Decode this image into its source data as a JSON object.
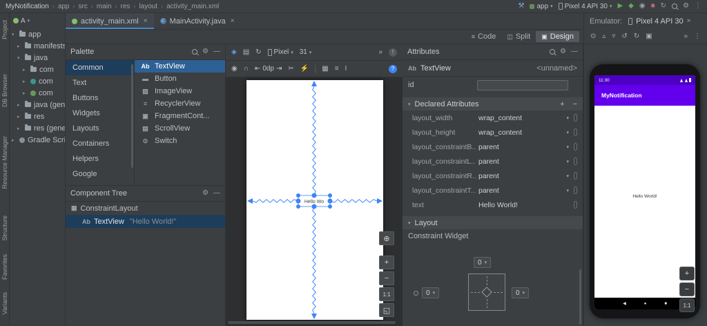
{
  "colors": {
    "accent": "#3d84f7",
    "tab_underline": "#4a88c7",
    "sel_bright": "#2d6094",
    "sel_dim": "#1d3d5a",
    "appbar_purple": "#6200ee",
    "statusbar_purple": "#4d00c4"
  },
  "icons": {
    "chevron_down": "▾",
    "chevron_right": "▸",
    "crumb_sep": "›",
    "gear": "⚙",
    "minimize": "—",
    "close": "×",
    "plus": "+",
    "minus": "−",
    "run": "▶",
    "debug": "◆",
    "profile": "◉",
    "stop": "■",
    "build": "⚒",
    "sync": "↻",
    "more_v": "⋮",
    "more_h": "»",
    "eye": "◉",
    "magnet": "∩",
    "margin_l": "⇤",
    "margin_r": "⇥",
    "clear_constraints": "✂",
    "infer_constraints": "⚡",
    "pack": "▦",
    "align": "≡",
    "guidelines": "I",
    "help": "?",
    "issues": "!",
    "design_surface": "◈",
    "blueprint": "▤",
    "power": "⊙",
    "volume_up": "▵",
    "volume_down": "▿",
    "rotate_left": "↺",
    "rotate_right": "↻",
    "screenshot_btn": "▣",
    "fold": "«",
    "pan": "⊕",
    "fit": "◱",
    "zoom_ratio": "1:1",
    "code_mode": "≡",
    "split_mode": "◫",
    "design_mode": "▣",
    "class_c": "C",
    "back_nav": "◀",
    "home_nav": "●",
    "recents_nav": "■"
  },
  "titlebar": {
    "project": "MyNotification",
    "breadcrumbs": [
      "app",
      "src",
      "main",
      "res",
      "layout",
      "activity_main.xml"
    ],
    "run_config": "app",
    "device": "Pixel 4 API 30"
  },
  "stripe": [
    "Project",
    "DB Browser",
    "Resource Manager",
    "Structure",
    "Favorites",
    "Variants"
  ],
  "project": {
    "view_label": "A",
    "items": [
      {
        "label": "app",
        "chev": "▾"
      },
      {
        "label": "manifests",
        "chev": "▸"
      },
      {
        "label": "java",
        "chev": "▾"
      },
      {
        "label": "com",
        "chev": "▸"
      },
      {
        "label": "com",
        "chev": "▸"
      },
      {
        "label": "com",
        "chev": "▸"
      },
      {
        "label": "java (generated)",
        "chev": "▸"
      },
      {
        "label": "res",
        "chev": "▸"
      },
      {
        "label": "res (generated)",
        "chev": "▸"
      },
      {
        "label": "Gradle Scripts",
        "chev": "▸"
      }
    ]
  },
  "tabs": [
    {
      "label": "activity_main.xml"
    },
    {
      "label": "MainActivity.java"
    }
  ],
  "mode_toggle": {
    "code": "Code",
    "split": "Split",
    "design": "Design"
  },
  "palette": {
    "title": "Palette",
    "categories": [
      "Common",
      "Text",
      "Buttons",
      "Widgets",
      "Layouts",
      "Containers",
      "Helpers",
      "Google"
    ],
    "items": [
      {
        "glyph": "Ab",
        "label": "TextView"
      },
      {
        "glyph": "▬",
        "label": "Button"
      },
      {
        "glyph": "▨",
        "label": "ImageView"
      },
      {
        "glyph": "≡",
        "label": "RecyclerView"
      },
      {
        "glyph": "▣",
        "label": "FragmentCont..."
      },
      {
        "glyph": "▤",
        "label": "ScrollView"
      },
      {
        "glyph": "⊙",
        "label": "Switch"
      }
    ]
  },
  "component_tree": {
    "title": "Component Tree",
    "root": {
      "glyph": "▦",
      "label": "ConstraintLayout"
    },
    "child": {
      "glyph": "Ab",
      "label": "TextView",
      "quote": "\"Hello World!\""
    }
  },
  "design": {
    "device": "Pixel",
    "api": "31",
    "default_margin": "0dp",
    "canvas_label": "Hello Wo"
  },
  "attributes": {
    "title": "Attributes",
    "component_glyph": "Ab",
    "component": "TextView",
    "unnamed": "<unnamed>",
    "id_label": "id",
    "id_value": "",
    "declared_section": "Declared Attributes",
    "rows": [
      {
        "name": "layout_width",
        "value": "wrap_content"
      },
      {
        "name": "layout_height",
        "value": "wrap_content"
      },
      {
        "name": "layout_constraintB...",
        "value": "parent"
      },
      {
        "name": "layout_constraintL...",
        "value": "parent"
      },
      {
        "name": "layout_constraintR...",
        "value": "parent"
      },
      {
        "name": "layout_constraintT...",
        "value": "parent"
      },
      {
        "name": "text",
        "value": "Hello World!"
      }
    ],
    "layout_section": "Layout",
    "constraint_widget_label": "Constraint Widget",
    "margin_top": "0",
    "margin_left": "0",
    "margin_right": "0"
  },
  "emulator": {
    "panel_label": "Emulator:",
    "tab_label": "Pixel 4 API 30",
    "status_time": "11:30",
    "appbar_title": "MyNotification",
    "content_text": "Hello World!"
  }
}
